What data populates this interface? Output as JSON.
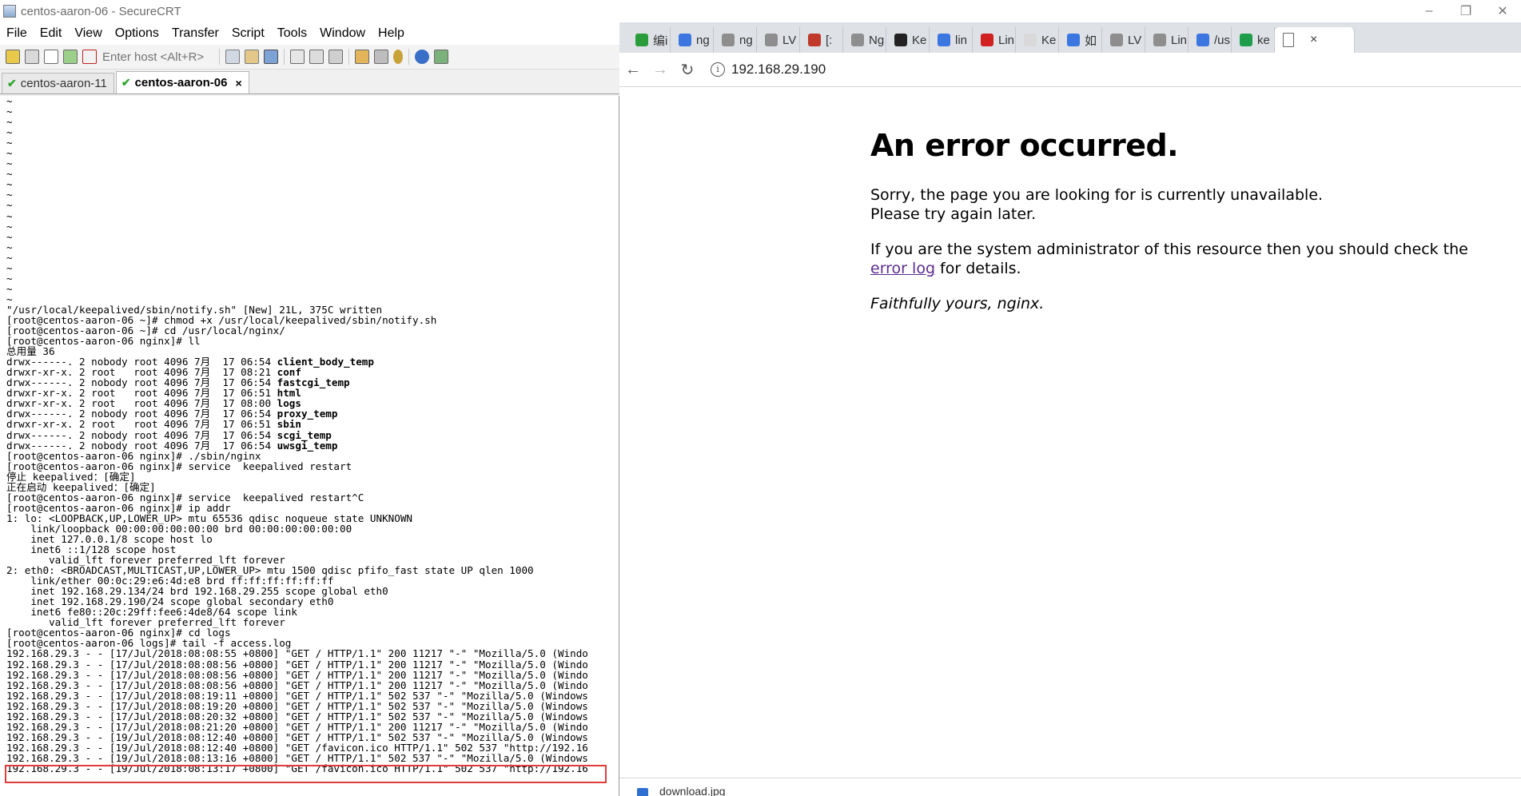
{
  "crt": {
    "window_title": "centos-aaron-06 - SecureCRT",
    "menu": [
      "File",
      "Edit",
      "View",
      "Options",
      "Transfer",
      "Script",
      "Tools",
      "Window",
      "Help"
    ],
    "host_placeholder": "Enter host <Alt+R>",
    "tabs": [
      {
        "label": "centos-aaron-11",
        "active": false
      },
      {
        "label": "centos-aaron-06",
        "active": true
      }
    ],
    "close_glyph": "×",
    "terminal_lines": [
      "~",
      "~",
      "~",
      "~",
      "~",
      "~",
      "~",
      "~",
      "~",
      "~",
      "~",
      "~",
      "~",
      "~",
      "~",
      "~",
      "~",
      "~",
      "~",
      "~",
      "\"/usr/local/keepalived/sbin/notify.sh\" [New] 21L, 375C written",
      "[root@centos-aaron-06 ~]# chmod +x /usr/local/keepalived/sbin/notify.sh",
      "[root@centos-aaron-06 ~]# cd /usr/local/nginx/",
      "[root@centos-aaron-06 nginx]# ll",
      "总用量 36",
      "drwx------. 2 nobody root 4096 7月  17 06:54 **client_body_temp**",
      "drwxr-xr-x. 2 root   root 4096 7月  17 08:21 **conf**",
      "drwx------. 2 nobody root 4096 7月  17 06:54 **fastcgi_temp**",
      "drwxr-xr-x. 2 root   root 4096 7月  17 06:51 **html**",
      "drwxr-xr-x. 2 root   root 4096 7月  17 08:00 **logs**",
      "drwx------. 2 nobody root 4096 7月  17 06:54 **proxy_temp**",
      "drwxr-xr-x. 2 root   root 4096 7月  17 06:51 **sbin**",
      "drwx------. 2 nobody root 4096 7月  17 06:54 **scgi_temp**",
      "drwx------. 2 nobody root 4096 7月  17 06:54 **uwsgi_temp**",
      "[root@centos-aaron-06 nginx]# ./sbin/nginx",
      "[root@centos-aaron-06 nginx]# service  keepalived restart",
      "停止 keepalived：[确定]",
      "正在启动 keepalived：[确定]",
      "[root@centos-aaron-06 nginx]# service  keepalived restart^C",
      "[root@centos-aaron-06 nginx]# ip addr",
      "1: lo: <LOOPBACK,UP,LOWER_UP> mtu 65536 qdisc noqueue state UNKNOWN",
      "    link/loopback 00:00:00:00:00:00 brd 00:00:00:00:00:00",
      "    inet 127.0.0.1/8 scope host lo",
      "    inet6 ::1/128 scope host",
      "       valid_lft forever preferred_lft forever",
      "2: eth0: <BROADCAST,MULTICAST,UP,LOWER_UP> mtu 1500 qdisc pfifo_fast state UP qlen 1000",
      "    link/ether 00:0c:29:e6:4d:e8 brd ff:ff:ff:ff:ff:ff",
      "    inet 192.168.29.134/24 brd 192.168.29.255 scope global eth0",
      "    inet 192.168.29.190/24 scope global secondary eth0",
      "    inet6 fe80::20c:29ff:fee6:4de8/64 scope link",
      "       valid_lft forever preferred_lft forever",
      "[root@centos-aaron-06 nginx]# cd logs",
      "[root@centos-aaron-06 logs]# tail -f access.log",
      "192.168.29.3 - - [17/Jul/2018:08:08:55 +0800] \"GET / HTTP/1.1\" 200 11217 \"-\" \"Mozilla/5.0 (Windo",
      "192.168.29.3 - - [17/Jul/2018:08:08:56 +0800] \"GET / HTTP/1.1\" 200 11217 \"-\" \"Mozilla/5.0 (Windo",
      "192.168.29.3 - - [17/Jul/2018:08:08:56 +0800] \"GET / HTTP/1.1\" 200 11217 \"-\" \"Mozilla/5.0 (Windo",
      "192.168.29.3 - - [17/Jul/2018:08:08:56 +0800] \"GET / HTTP/1.1\" 200 11217 \"-\" \"Mozilla/5.0 (Windo",
      "192.168.29.3 - - [17/Jul/2018:08:19:11 +0800] \"GET / HTTP/1.1\" 502 537 \"-\" \"Mozilla/5.0 (Windows",
      "192.168.29.3 - - [17/Jul/2018:08:19:20 +0800] \"GET / HTTP/1.1\" 502 537 \"-\" \"Mozilla/5.0 (Windows",
      "192.168.29.3 - - [17/Jul/2018:08:20:32 +0800] \"GET / HTTP/1.1\" 502 537 \"-\" \"Mozilla/5.0 (Windows",
      "192.168.29.3 - - [17/Jul/2018:08:21:20 +0800] \"GET / HTTP/1.1\" 200 11217 \"-\" \"Mozilla/5.0 (Windo",
      "192.168.29.3 - - [19/Jul/2018:08:12:40 +0800] \"GET / HTTP/1.1\" 502 537 \"-\" \"Mozilla/5.0 (Windows",
      "192.168.29.3 - - [19/Jul/2018:08:12:40 +0800] \"GET /favicon.ico HTTP/1.1\" 502 537 \"http://192.16",
      "192.168.29.3 - - [19/Jul/2018:08:13:16 +0800] \"GET / HTTP/1.1\" 502 537 \"-\" \"Mozilla/5.0 (Windows",
      "192.168.29.3 - - [19/Jul/2018:08:13:17 +0800] \"GET /favicon.ico HTTP/1.1\" 502 537 \"http://192.16"
    ]
  },
  "browser": {
    "window_controls": [
      "–",
      "❐",
      "✕"
    ],
    "tabs": [
      {
        "label": "编i",
        "favicon": "#2a9d3a"
      },
      {
        "label": "ng",
        "favicon": "#3b76e1"
      },
      {
        "label": "ng",
        "favicon": "#8e8e8e"
      },
      {
        "label": "LV",
        "favicon": "#8e8e8e"
      },
      {
        "label": "[:",
        "favicon": "#c0392b"
      },
      {
        "label": "Ng",
        "favicon": "#8e8e8e"
      },
      {
        "label": "Ke",
        "favicon": "#222222"
      },
      {
        "label": "lin",
        "favicon": "#3b76e1"
      },
      {
        "label": "Lin",
        "favicon": "#d02020"
      },
      {
        "label": "Ke",
        "favicon": "#d9d9d9"
      },
      {
        "label": "如",
        "favicon": "#3b76e1"
      },
      {
        "label": "LV",
        "favicon": "#8e8e8e"
      },
      {
        "label": "Lin",
        "favicon": "#8e8e8e"
      },
      {
        "label": "/us",
        "favicon": "#3b76e1"
      },
      {
        "label": "ke",
        "favicon": "#1e9e4a"
      }
    ],
    "active_tab_close": "×",
    "nav": {
      "back": "←",
      "forward": "→",
      "reload": "↻",
      "info": "i"
    },
    "url": "192.168.29.190",
    "page": {
      "heading": "An error occurred.",
      "para1_line1": "Sorry, the page you are looking for is currently unavailable.",
      "para1_line2": "Please try again later.",
      "para2_before": "If you are the system administrator of this resource then you should check the",
      "para2_link": "error log",
      "para2_after": " for details.",
      "signature": "Faithfully yours, nginx."
    },
    "download_name": "download.jpg"
  },
  "colors": {
    "highlight_box": "#e23b3b",
    "link": "#5b2b8f",
    "tabstrip": "#dee1e6"
  }
}
